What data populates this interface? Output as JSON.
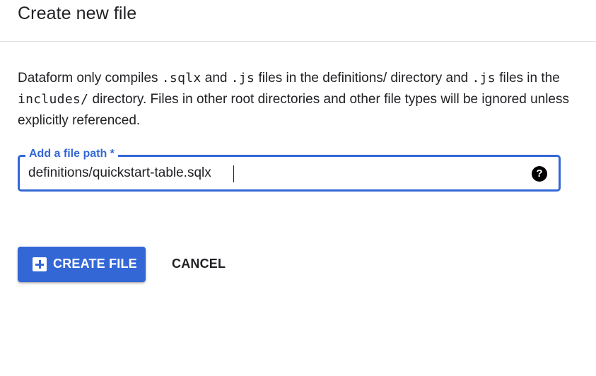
{
  "dialog": {
    "title": "Create new file",
    "description": {
      "part1": "Dataform only compiles ",
      "code1": ".sqlx",
      "part2": " and ",
      "code2": ".js",
      "part3": " files in the definitions/ directory and ",
      "code3": ".js",
      "part4": " files in the ",
      "code4": "includes/",
      "part5": " directory. Files in other root directories and other file types will be ignored unless explicitly referenced."
    },
    "file_path_field": {
      "label": "Add a file path *",
      "value": "definitions/quickstart-table.sqlx",
      "help_icon": "help-icon",
      "help_glyph": "?"
    },
    "buttons": {
      "create_label": "CREATE FILE",
      "create_icon": "add-box-icon",
      "cancel_label": "CANCEL"
    }
  },
  "colors": {
    "accent": "#3367d6",
    "text": "#202124",
    "divider": "#e0e0e0",
    "background": "#ffffff"
  }
}
